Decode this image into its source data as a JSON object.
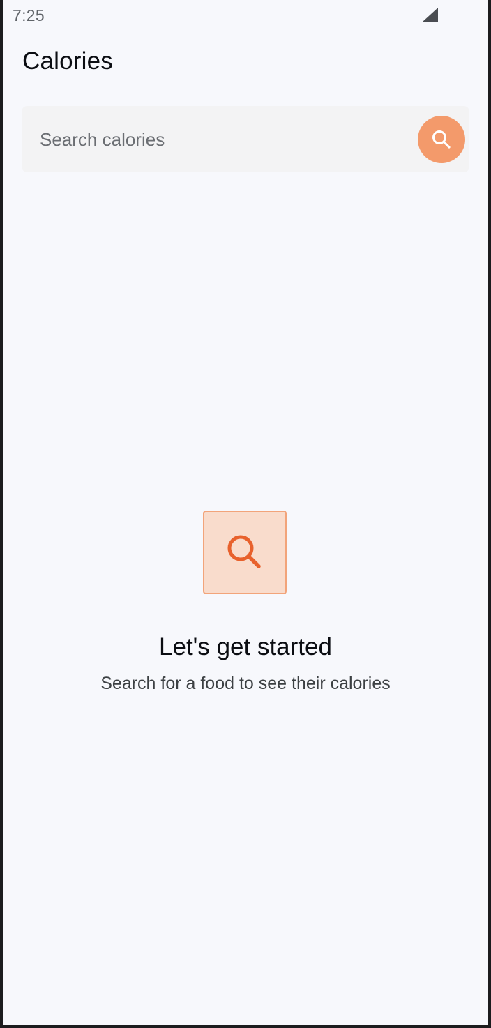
{
  "status_bar": {
    "time": "7:25",
    "signal_icon": "cellular-signal-icon"
  },
  "header": {
    "title": "Calories"
  },
  "search": {
    "placeholder": "Search calories",
    "value": "",
    "button_icon": "search-icon"
  },
  "empty_state": {
    "icon": "search-icon",
    "title": "Let's get started",
    "subtitle": "Search for a food to see their calories"
  },
  "colors": {
    "background": "#f7f8fc",
    "accent": "#f39a6b",
    "accent_dark": "#e8612c",
    "icon_box_fill": "#f9dccc",
    "icon_box_border": "#f2a47a"
  }
}
